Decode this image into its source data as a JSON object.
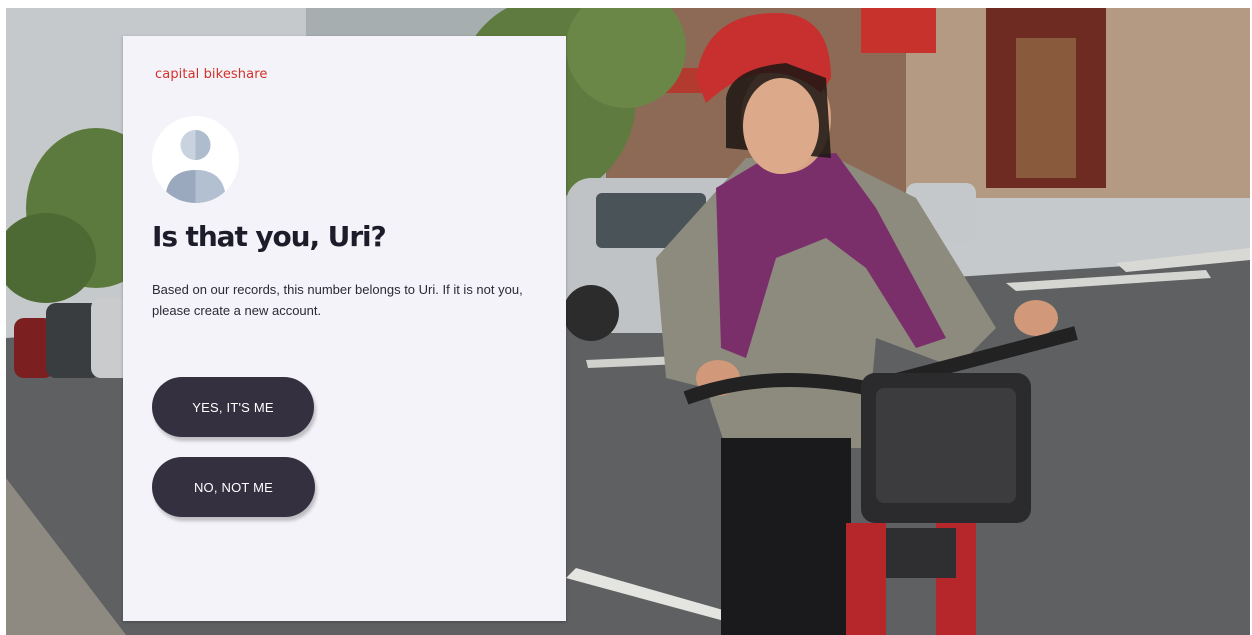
{
  "brand": {
    "name": "capital bikeshare",
    "color": "#d3322a"
  },
  "avatar": {
    "icon": "user-avatar-icon"
  },
  "prompt": {
    "title": "Is that you, Uri?",
    "description": "Based on our records, this number belongs to Uri. If it is not you, please create a new account."
  },
  "actions": {
    "yes_label": "YES, IT'S ME",
    "no_label": "NO, NOT ME",
    "button_color": "#34303f"
  },
  "background": {
    "image": "woman-riding-bikeshare-bicycle-photo"
  }
}
